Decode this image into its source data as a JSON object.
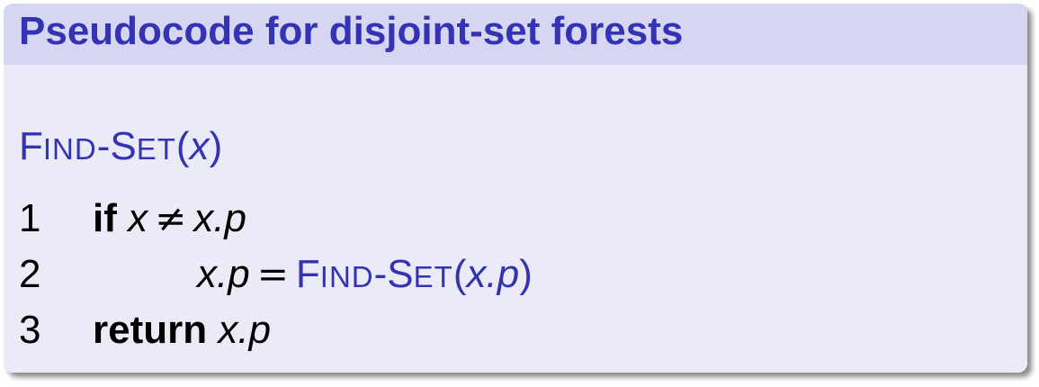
{
  "title": "Pseudocode for disjoint-set forests",
  "procedure": {
    "name_big_1": "F",
    "name_small_1": "IND",
    "name_dash": "-",
    "name_big_2": "S",
    "name_small_2": "ET",
    "open_paren": "(",
    "param": "x",
    "close_paren": ")"
  },
  "lines": [
    {
      "number": "1",
      "keyword": "if",
      "lhs": "x",
      "operator": "≠",
      "rhs": "x.p"
    },
    {
      "number": "2",
      "lhs": "x.p",
      "operator": "=",
      "call_big_1": "F",
      "call_small_1": "IND",
      "call_dash": "-",
      "call_big_2": "S",
      "call_small_2": "ET",
      "call_open": "(",
      "call_arg": "x.p",
      "call_close": ")"
    },
    {
      "number": "3",
      "keyword": "return",
      "value": "x.p"
    }
  ]
}
